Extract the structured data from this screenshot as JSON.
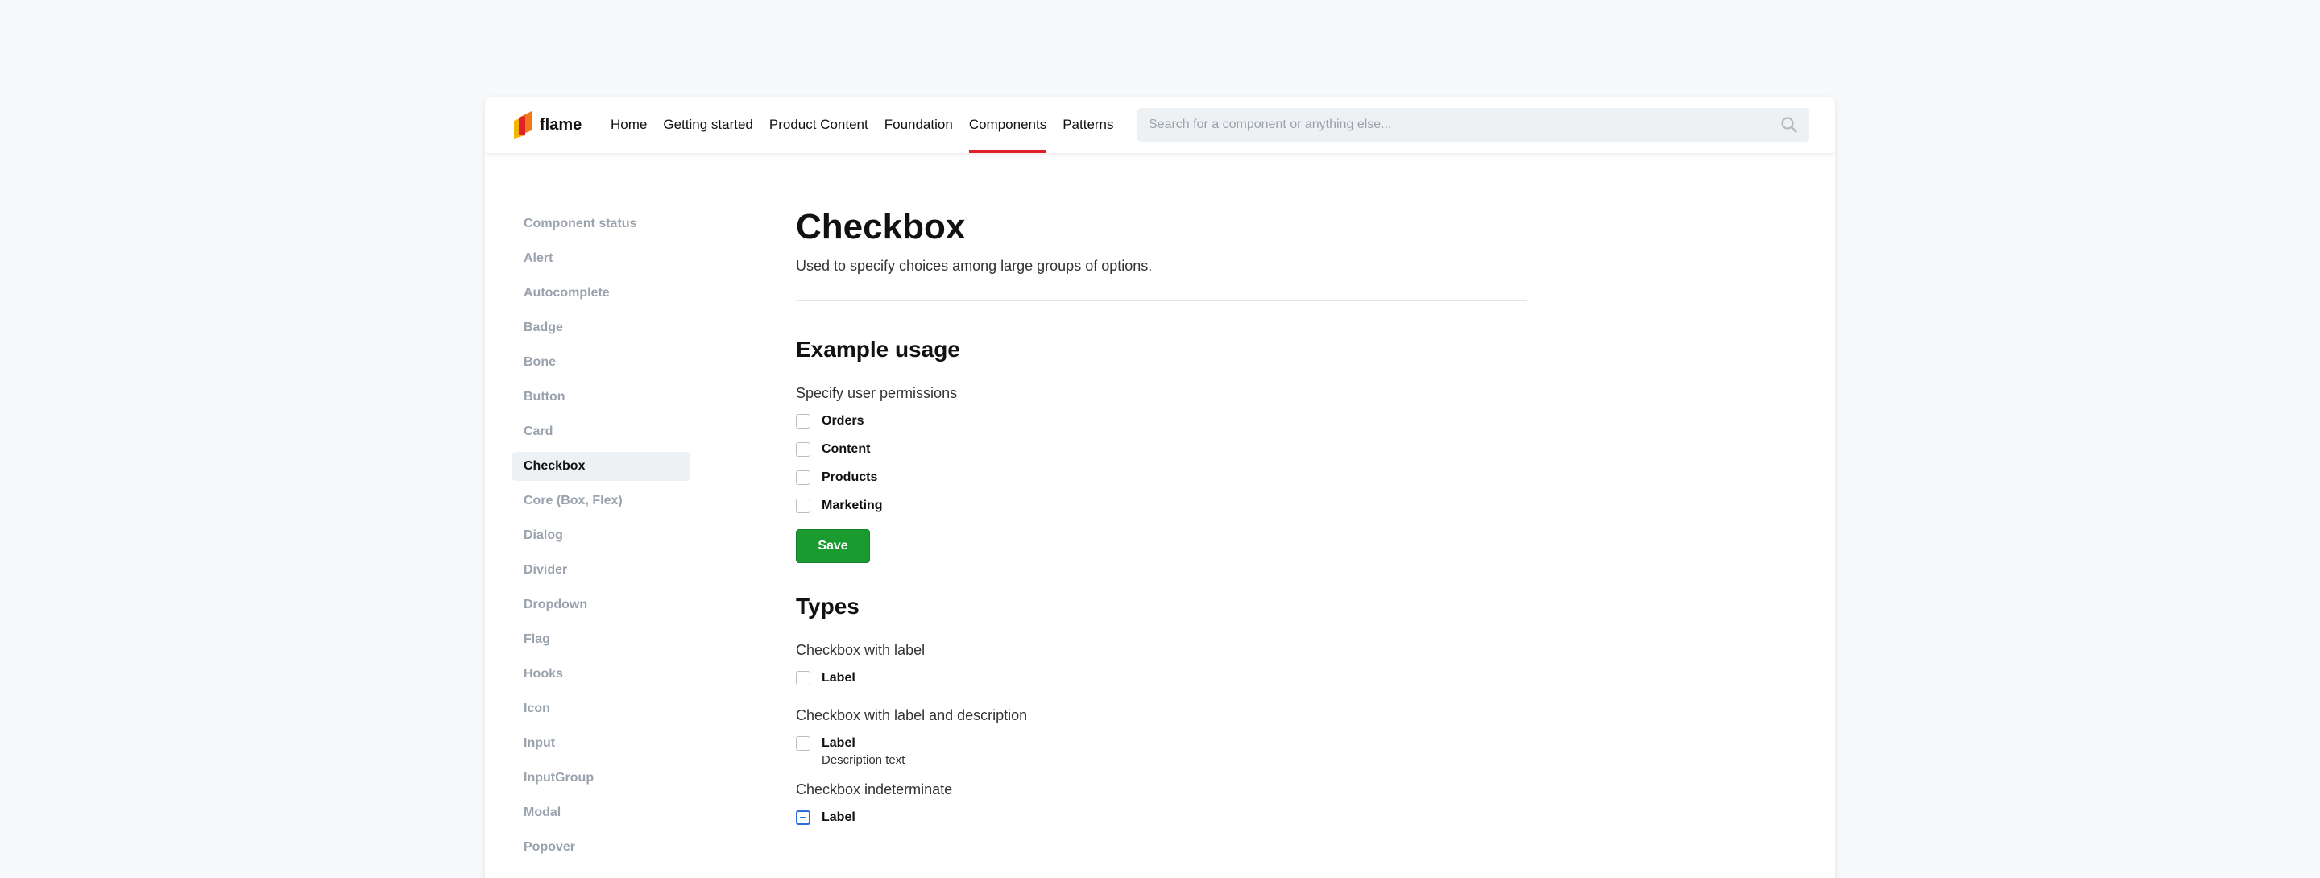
{
  "brand": {
    "name": "flame"
  },
  "nav": {
    "items": [
      {
        "label": "Home"
      },
      {
        "label": "Getting started"
      },
      {
        "label": "Product Content"
      },
      {
        "label": "Foundation"
      },
      {
        "label": "Components",
        "active": true
      },
      {
        "label": "Patterns"
      }
    ]
  },
  "search": {
    "placeholder": "Search for a component or anything else..."
  },
  "sidebar": {
    "items": [
      {
        "label": "Component status"
      },
      {
        "label": "Alert"
      },
      {
        "label": "Autocomplete"
      },
      {
        "label": "Badge"
      },
      {
        "label": "Bone"
      },
      {
        "label": "Button"
      },
      {
        "label": "Card"
      },
      {
        "label": "Checkbox",
        "active": true
      },
      {
        "label": "Core (Box, Flex)"
      },
      {
        "label": "Dialog"
      },
      {
        "label": "Divider"
      },
      {
        "label": "Dropdown"
      },
      {
        "label": "Flag"
      },
      {
        "label": "Hooks"
      },
      {
        "label": "Icon"
      },
      {
        "label": "Input"
      },
      {
        "label": "InputGroup"
      },
      {
        "label": "Modal"
      },
      {
        "label": "Popover"
      }
    ]
  },
  "page": {
    "title": "Checkbox",
    "subtitle": "Used to specify choices among large groups of options."
  },
  "example": {
    "title": "Example usage",
    "group_label": "Specify user permissions",
    "options": [
      {
        "label": "Orders",
        "checked": false
      },
      {
        "label": "Content",
        "checked": false
      },
      {
        "label": "Products",
        "checked": false
      },
      {
        "label": "Marketing",
        "checked": false
      }
    ],
    "save_label": "Save"
  },
  "types": {
    "title": "Types",
    "with_label": {
      "heading": "Checkbox with label",
      "label": "Label"
    },
    "with_description": {
      "heading": "Checkbox with label and description",
      "label": "Label",
      "description": "Description text"
    },
    "indeterminate": {
      "heading": "Checkbox indeterminate",
      "label": "Label",
      "state": "indeterminate"
    }
  },
  "colors": {
    "accent_red": "#e0202a",
    "save_green": "#1a9b2f",
    "indeterminate_blue": "#2a6ee0"
  }
}
